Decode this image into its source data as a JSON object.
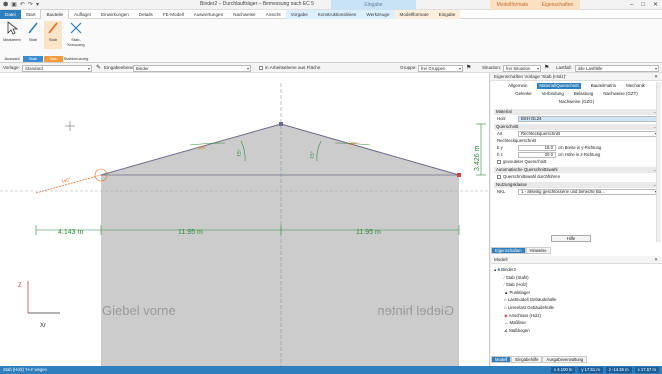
{
  "title": "Binder2 – Durchlaufträger – Bemessung nach EC 5",
  "context_tabs": {
    "eingabe": "Eingabe",
    "modell1": "Modellformate",
    "modell2": "Eigenschaften"
  },
  "tabs": [
    "Datei",
    "Start",
    "Bauteile",
    "Auflager",
    "Einwirkungen",
    "Details",
    "FE-Modell",
    "Auswertungen",
    "Nachweise",
    "Ansicht",
    "Vorgabe",
    "Konstruktionslinien",
    "Werkzeuge",
    "Modellformate",
    "Eingabe"
  ],
  "ribbon": {
    "btn_markieren": "Markieren",
    "btn_stab": "Stab",
    "btn_stab2": "Stab",
    "btn_stabkreuzung": "Stab-Kreuzung",
    "grp_auswahl": "Auswahl",
    "grp_stab": "Stab",
    "grp_stab2": "Stab",
    "grp_stabkreuzung": "Stabkreuzung"
  },
  "toolbar": {
    "vorlage_label": "Vorlage:",
    "vorlage_value": "Standard",
    "ebene_label": "Eingabeebene:",
    "ebene_value": "Binder",
    "arbeitsebene_label": "in Arbeitsebene aus Fläche",
    "gruppe_label": "Gruppe:",
    "gruppe_value": "frei Gruppen",
    "situation_label": "Situation:",
    "situation_value": "frei Situation",
    "lastfall_label": "Lastfall:",
    "lastfall_value": "alle Lastfälle"
  },
  "drawing": {
    "dim_left": "4.143 m",
    "dim_mid1": "11.95 m",
    "dim_mid2": "11.95 m",
    "dim_height": "3.426 m",
    "angle_left": "15°",
    "angle_right": "15°",
    "angle_top_left": "165°",
    "angle_top_right": "165°",
    "angle_far": "165°",
    "label_front": "Giebel vorne",
    "label_back": "Giebel hinten",
    "axis_x": "Xr",
    "axis_z": "Z"
  },
  "properties": {
    "header": "Eigenschaften Vorlage 'Stab (Holz)'",
    "tabs": [
      "Allgemein",
      "Material/Querschnitt",
      "Bauteilmatrix",
      "Mechanik",
      "Gelenke",
      "Verbindung",
      "Belastung",
      "Nachweise (GZT)",
      "Nachweise (GZG)"
    ],
    "active_tab": "Material/Querschnitt",
    "sec_material": "Material",
    "holz_label": "Holz",
    "holz_value": "BSH GL24",
    "sec_querschnitt": "Querschnitt",
    "art_label": "Art",
    "art_value": "Rechteckquerschnitt",
    "rq_label": "Rechteckquerschnitt",
    "by_label": "b y",
    "by_value": "16.0",
    "by_unit": "cm  Breite in y-Richtung",
    "hz_label": "h z",
    "hz_value": "20.0",
    "hz_unit": "cm  Höhe in z-Richtung",
    "gevoutet": "gevouteter Querschnitt",
    "sec_auto": "Automatische Querschnittswahl",
    "auto_chk": "Querschnittswahl durchführen",
    "sec_nutz": "Nutzungsklasse",
    "nkl_label": "NKL",
    "nkl_value": "1 - allseitig geschlossene und beheizte Ba...",
    "hilfe": "Hilfe",
    "bottom_tab1": "Eigenschaften",
    "bottom_tab2": "Hinweise"
  },
  "model": {
    "header": "Modell",
    "items": [
      "Binder2",
      "Stab (Stahl)",
      "Stab (Holz)",
      "Punktlager",
      "Lastmodell Gebäudehülle",
      "Linienlast Gebäudehülle",
      "Anschluss (Holz)",
      "Maßlinie",
      "Maßbogen"
    ],
    "bottom_tabs": [
      "Modell",
      "Eingabehilfe",
      "Ausgabeverwaltung"
    ]
  },
  "status": {
    "text": "Stab (Holz) 'H-4' wegen",
    "fields": [
      "x 4.100 m",
      "y 17.51 m",
      "z -14.36 m",
      "x 17.57 m"
    ]
  },
  "colors": {
    "accent": "#2f7ebd",
    "fill": "#cccccc",
    "green": "#2e8b3e",
    "orange": "#e0702a"
  }
}
